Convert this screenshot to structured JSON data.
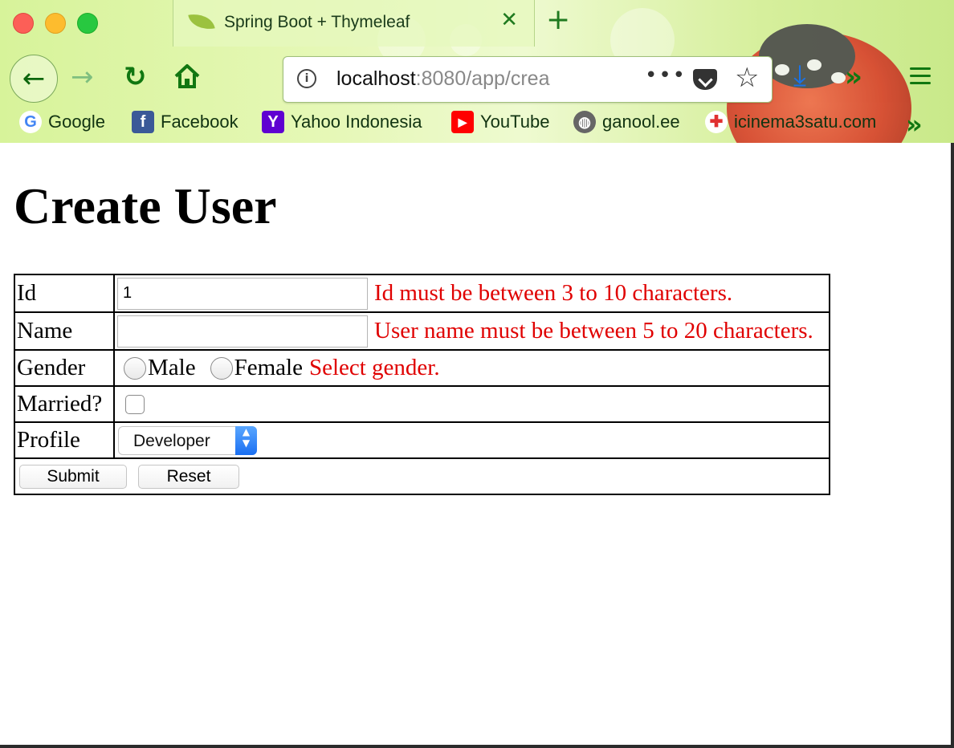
{
  "browser": {
    "tab_title": "Spring Boot + Thymeleaf",
    "url_host": "localhost",
    "url_rest": ":8080/app/crea",
    "more_label": "•••",
    "bookmarks": [
      {
        "label": "Google",
        "icon": "google-icon"
      },
      {
        "label": "Facebook",
        "icon": "facebook-icon"
      },
      {
        "label": "Yahoo Indonesia",
        "icon": "yahoo-icon"
      },
      {
        "label": "YouTube",
        "icon": "youtube-icon"
      },
      {
        "label": "ganool.ee",
        "icon": "globe-icon"
      },
      {
        "label": "icinema3satu.com",
        "icon": "site-icon"
      }
    ],
    "accent_color": "#117711"
  },
  "page": {
    "title": "Create User",
    "form": {
      "id": {
        "label": "Id",
        "value": "1",
        "error": "Id must be between 3 to 10 characters."
      },
      "name": {
        "label": "Name",
        "value": "",
        "error": "User name must be between 5 to 20 characters."
      },
      "gender": {
        "label": "Gender",
        "options": [
          "Male",
          "Female"
        ],
        "error": "Select gender."
      },
      "married": {
        "label": "Married?",
        "checked": false
      },
      "profile": {
        "label": "Profile",
        "selected": "Developer"
      },
      "submit_label": "Submit",
      "reset_label": "Reset",
      "error_color": "#e00000"
    }
  }
}
